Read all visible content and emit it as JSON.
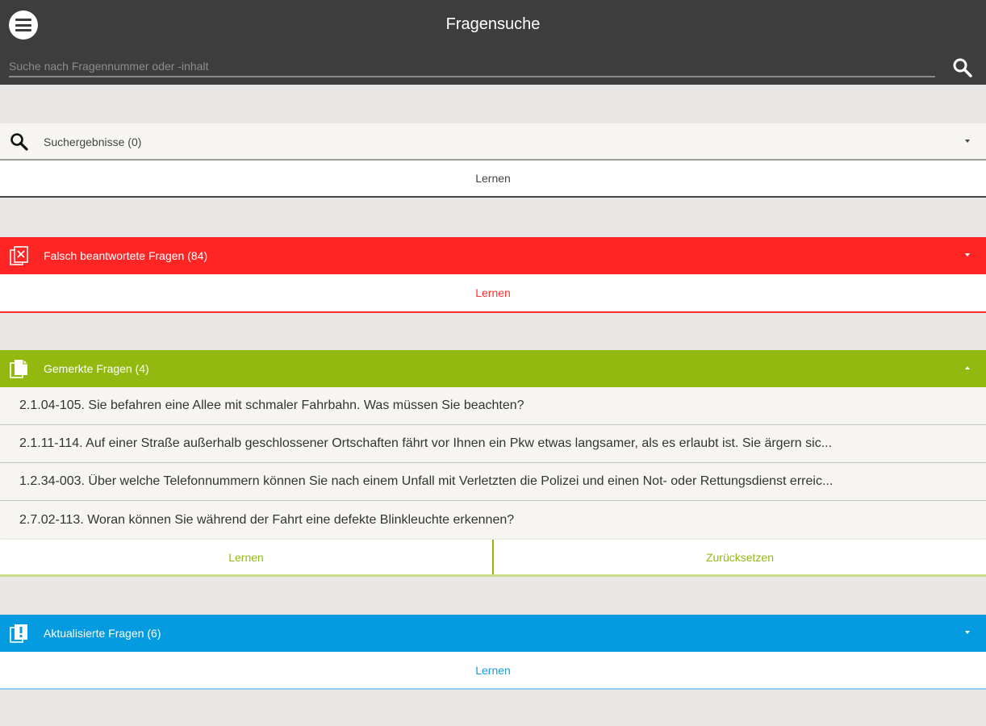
{
  "header": {
    "title": "Fragensuche",
    "search_placeholder": "Suche nach Fragennummer oder -inhalt",
    "menu_icon": "menu-icon",
    "search_icon": "search-icon"
  },
  "sections": [
    {
      "title": "Suchergebnisse (0)",
      "icon": "search-icon",
      "color": "#f6f5f2",
      "expanded": false,
      "learn_label": "Lernen"
    },
    {
      "title": "Falsch beantwortete Fragen (84)",
      "icon": "wrong-answers-icon",
      "color": "#ff2525",
      "expanded": false,
      "learn_label": "Lernen"
    },
    {
      "title": "Gemerkte Fragen (4)",
      "icon": "bookmarked-questions-icon",
      "color": "#93b810",
      "expanded": true,
      "items": [
        "2.1.04-105. Sie befahren eine Allee mit schmaler Fahrbahn. Was müssen Sie beachten?",
        "2.1.11-114. Auf einer Straße außerhalb geschlossener Ortschaften fährt vor Ihnen ein Pkw etwas langsamer, als es erlaubt ist. Sie ärgern sic...",
        "1.2.34-003. Über welche Telefonnummern können Sie nach einem Unfall mit Verletzten die Polizei und einen Not- oder Rettungsdienst erreic...",
        "2.7.02-113. Woran können Sie während der Fahrt eine defekte Blinkleuchte erkennen?"
      ],
      "learn_label": "Lernen",
      "reset_label": "Zurücksetzen"
    },
    {
      "title": "Aktualisierte Fragen (6)",
      "icon": "updated-questions-icon",
      "color": "#059be0",
      "expanded": false,
      "learn_label": "Lernen"
    }
  ]
}
